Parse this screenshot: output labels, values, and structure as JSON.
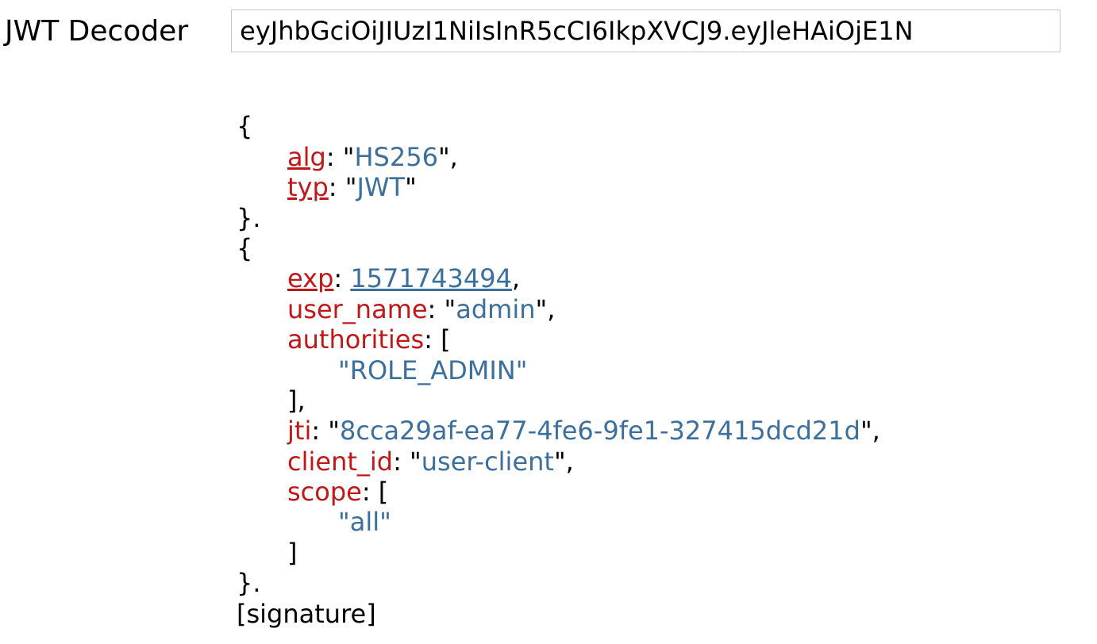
{
  "header": {
    "title": "JWT Decoder",
    "jwt_value": "eyJhbGciOiJIUzI1NiIsInR5cCI6IkpXVCJ9.eyJleHAiOjE1N"
  },
  "decoded": {
    "open_brace": "{",
    "close_brace_dot": "}.",
    "open_bracket": "[",
    "close_bracket": "]",
    "close_bracket_comma": "],",
    "colon_quote": ": \"",
    "colon_space": ": ",
    "quote_comma": "\",",
    "quote": "\"",
    "comma": ",",
    "header_keys": {
      "alg": "alg",
      "typ": "typ"
    },
    "header_vals": {
      "alg": "HS256",
      "typ": "JWT"
    },
    "payload_keys": {
      "exp": "exp",
      "user_name": "user_name",
      "authorities": "authorities",
      "jti": "jti",
      "client_id": "client_id",
      "scope": "scope"
    },
    "payload_vals": {
      "exp": "1571743494",
      "user_name": "admin",
      "authorities0": "\"ROLE_ADMIN\"",
      "jti": "8cca29af-ea77-4fe6-9fe1-327415dcd21d",
      "client_id": "user-client",
      "scope0": "\"all\""
    },
    "signature": "[signature]"
  }
}
